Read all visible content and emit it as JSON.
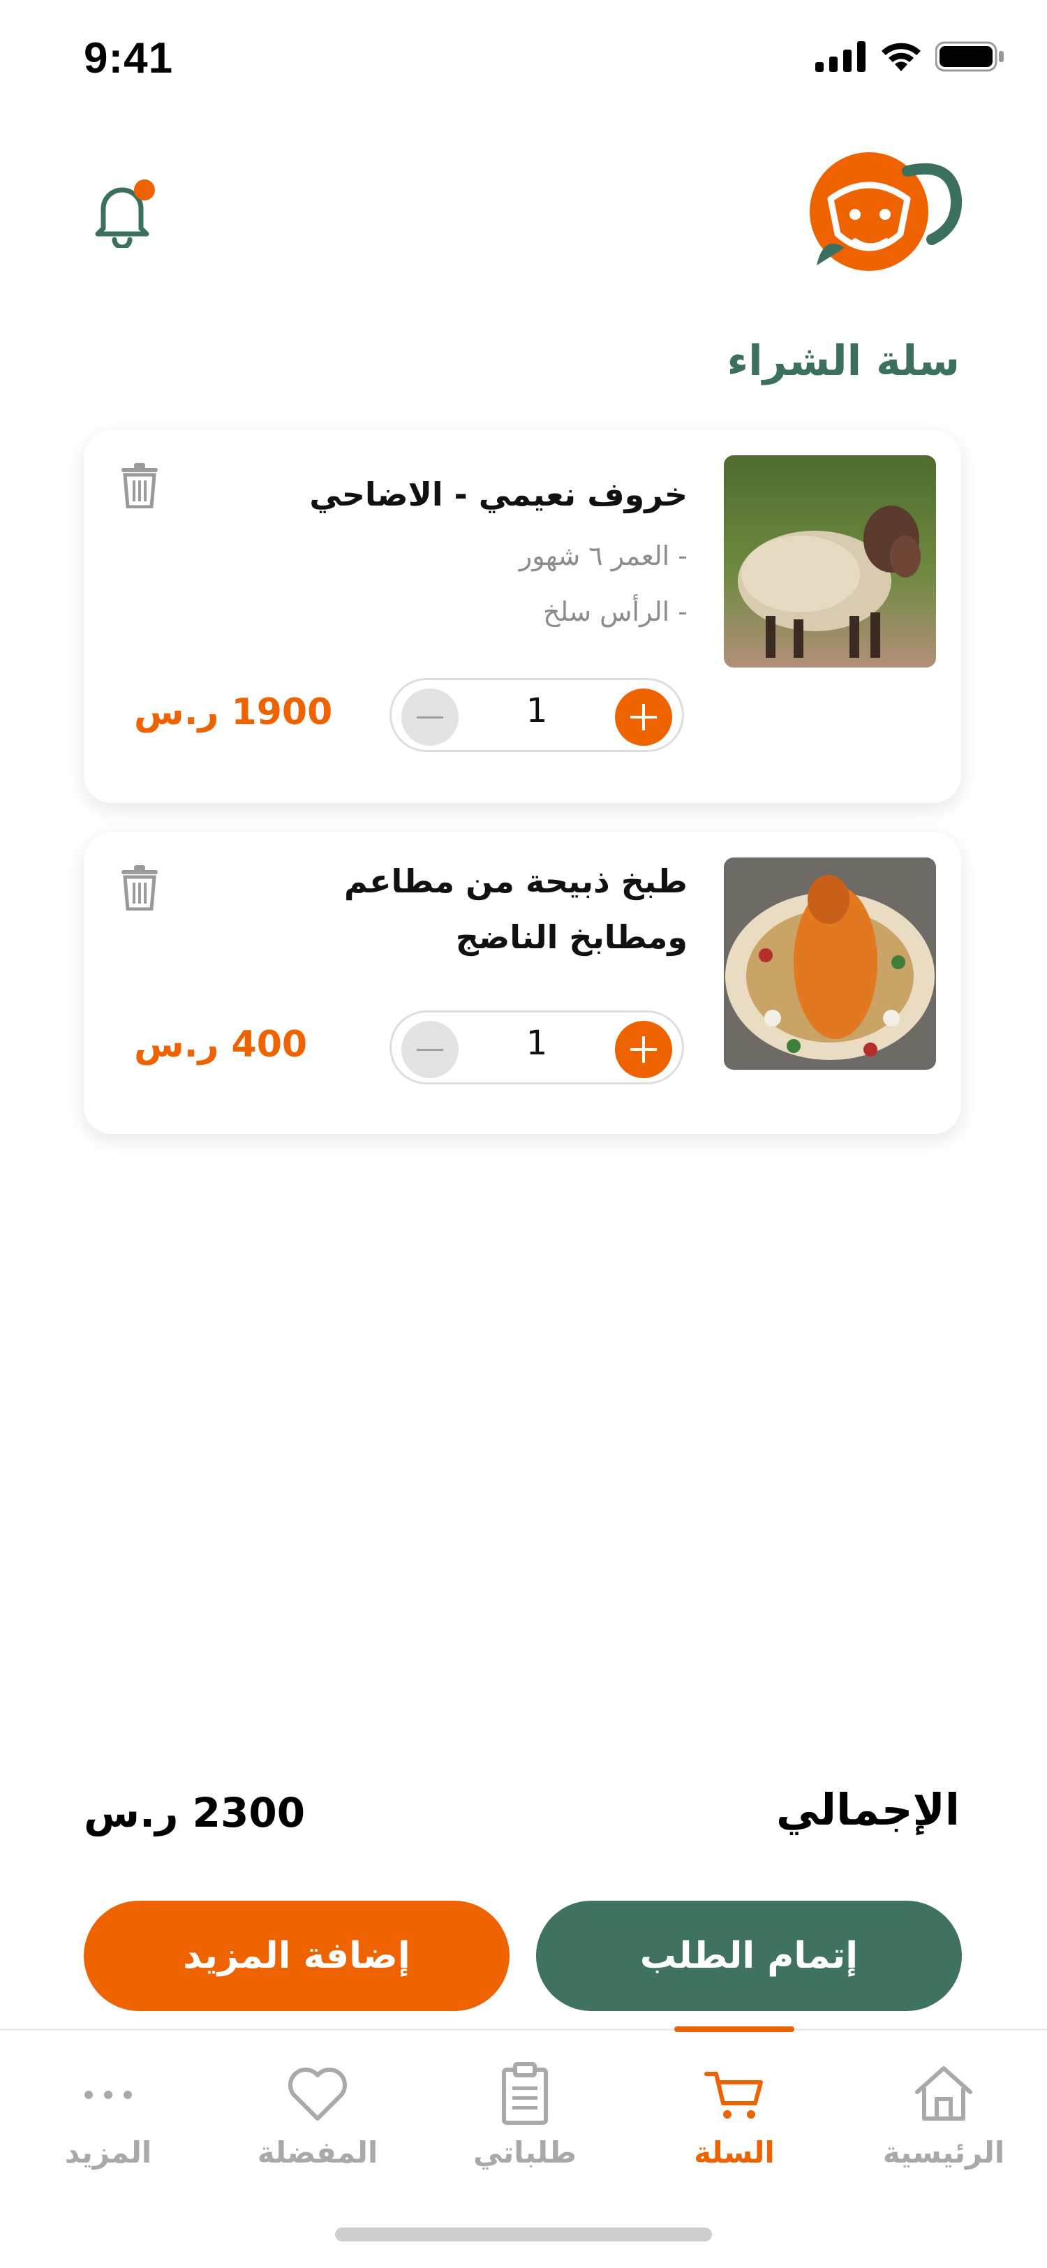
{
  "status_bar": {
    "time": "9:41"
  },
  "header": {
    "notification_badge_color": "#ee6300",
    "brand_color": "#ee6300",
    "accent_color": "#3b6f5e"
  },
  "page_title": "سلة الشراء",
  "cart": {
    "items": [
      {
        "title": "خروف نعيمي - الاضاحي",
        "details": [
          "- العمر ٦ شهور",
          "- الرأس سلخ"
        ],
        "quantity": "1",
        "price": "1900 ر.س",
        "image": "sheep-photo"
      },
      {
        "title_lines": [
          "طبخ ذبيحة من مطاعم",
          "ومطابخ الناضج"
        ],
        "quantity": "1",
        "price": "400 ر.س",
        "image": "cooked-lamb-dish-photo"
      }
    ]
  },
  "summary": {
    "total_label": "الإجمالي",
    "total_value": "2300 ر.س"
  },
  "actions": {
    "checkout_label": "إتمام الطلب",
    "add_more_label": "إضافة المزيد"
  },
  "bottom_nav": {
    "active": "cart",
    "items": [
      {
        "key": "home",
        "label": "الرئيسية",
        "icon": "home-icon"
      },
      {
        "key": "cart",
        "label": "السلة",
        "icon": "cart-icon"
      },
      {
        "key": "orders",
        "label": "طلباتي",
        "icon": "clipboard-icon"
      },
      {
        "key": "favorites",
        "label": "المفضلة",
        "icon": "heart-icon"
      },
      {
        "key": "more",
        "label": "المزيد",
        "icon": "more-dots-icon"
      }
    ]
  }
}
